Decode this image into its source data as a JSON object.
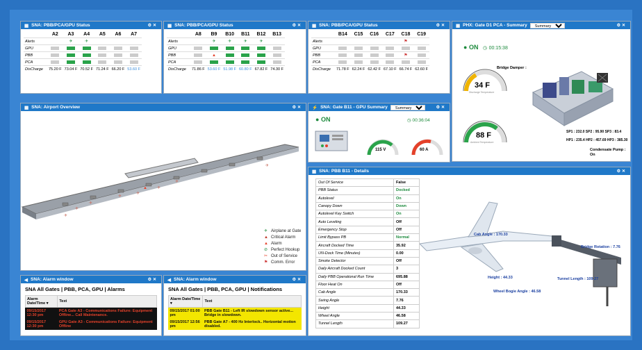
{
  "pbb_a": {
    "title": "SNA: PBB/PCA/GPU Status",
    "columns": [
      "A2",
      "A3",
      "A4",
      "A5",
      "A6",
      "A7"
    ],
    "row_labels": [
      "Alerts",
      "GPU",
      "PBB",
      "PCA",
      "DisCharge"
    ],
    "discharge": [
      "75.20 F",
      "73.04 F",
      "70.52 F",
      "71.24 F",
      "66.20 F",
      "53.60 F"
    ]
  },
  "pbb_b": {
    "title": "SNA: PBB/PCA/GPU Status",
    "columns": [
      "A8",
      "B9",
      "B10",
      "B11",
      "B12",
      "B13"
    ],
    "row_labels": [
      "Alerts",
      "GPU",
      "PBB",
      "PCA",
      "DisCharge"
    ],
    "discharge": [
      "71.86 F",
      "53.60 F",
      "51.98 F",
      "60.80 F",
      "67.82 F",
      "74.30 F"
    ]
  },
  "pbb_c": {
    "title": "SNA: PBB/PCA/GPU Status",
    "columns": [
      "B14",
      "C15",
      "C16",
      "C17",
      "C18",
      "C19"
    ],
    "row_labels": [
      "Alerts",
      "GPU",
      "PBB",
      "PCA",
      "DisCharge"
    ],
    "discharge": [
      "71.78 F",
      "62.24 F",
      "62.42 F",
      "67.10 F",
      "66.74 F",
      "62.60 F"
    ]
  },
  "phx": {
    "title": "PHX: Gate D1 PCA - Summary",
    "select": "Summary",
    "status": "ON",
    "timer": "00:15:38",
    "gauge1_value": "34 F",
    "gauge1_caption": "Discharge Temperature",
    "gauge2_value": "88 F",
    "gauge2_caption": "Ambient Temperature",
    "bridge_damper": "Bridge Damper :",
    "sp_line": "SP1 : 232.0 SP2 : 95.90  SP3 : 83.4",
    "hp_line": "HP1 : 235.4 HP2 : 457.69 HP3 : 385.30",
    "condensate": "Condensate Pump :",
    "condensate_val": "On"
  },
  "overview": {
    "title": "SNA: Airport Overview",
    "legend": [
      {
        "icon": "✈",
        "text": "Airplane at Gate"
      },
      {
        "icon": "▲",
        "text": "Critical Alarm"
      },
      {
        "icon": "▲",
        "text": "Alarm"
      },
      {
        "icon": "⊘",
        "text": "Perfect Hookup"
      },
      {
        "icon": "✂",
        "text": "Out of Service"
      },
      {
        "icon": "⚑",
        "text": "Comm. Error"
      }
    ]
  },
  "gpu": {
    "title": "SNA: Gate B11 - GPU Summary",
    "select": "Summary",
    "status": "ON",
    "timer": "00:36:04",
    "volt": "115 V",
    "amp": "60 A"
  },
  "details": {
    "title": "SNA: PBB B11 - Details",
    "rows": [
      {
        "k": "Out Of Service",
        "v": "False"
      },
      {
        "k": "PBB Status",
        "v": "Docked"
      },
      {
        "k": "Autolevel",
        "v": "On"
      },
      {
        "k": "Canopy Down",
        "v": "Down"
      },
      {
        "k": "Autolevel Key Switch",
        "v": "On"
      },
      {
        "k": "Auto Leveling",
        "v": "Off"
      },
      {
        "k": "Emergency Stop",
        "v": "Off"
      },
      {
        "k": "Limit Bypass PB",
        "v": "Normal"
      },
      {
        "k": "Aircraft Docked Time",
        "v": "35.92"
      },
      {
        "k": "UN-Dock Time (Minutes)",
        "v": "0.00"
      },
      {
        "k": "Smoke Detector",
        "v": "Off"
      },
      {
        "k": "Daily Aircraft Docked Count",
        "v": "3"
      },
      {
        "k": "Daily PBB Operational Run Time",
        "v": "695.88"
      },
      {
        "k": "Floor Heat On",
        "v": "Off"
      },
      {
        "k": "Cab Angle",
        "v": "170.33"
      },
      {
        "k": "Swing Angle",
        "v": "7.76"
      },
      {
        "k": "Height",
        "v": "44.33"
      },
      {
        "k": "Wheel Angle",
        "v": "46.58"
      },
      {
        "k": "Tunnel Length",
        "v": "109.27"
      }
    ],
    "labels": {
      "cab": "Cab Angle : 170.33",
      "rotation": "Bridge Rotation : 7.76",
      "height": "Height : 44.33",
      "tunnel": "Tunnel Length : 109.27",
      "wheel": "Wheel Bogie Angle : 46.58"
    }
  },
  "alarm1": {
    "title": "SNA: Alarm window",
    "heading": "SNA All Gates | PBB, PCA, GPU | Alarms",
    "col_time": "Alarm Date/Time",
    "col_text": "Text",
    "rows": [
      {
        "time": "09/15/2017 12:30 pm",
        "text": "PCA Gate A3 - Communications Failure: Equipment Offline... Call Maintenance."
      },
      {
        "time": "09/15/2017 12:30 pm",
        "text": "GPU Gate A3 - Communications Failure: Equipment Offline"
      }
    ]
  },
  "alarm2": {
    "title": "SNA: Alarm window",
    "heading": "SNA All Gates | PBB, PCA, GPU | Notifications",
    "col_time": "Alarm Date/Time",
    "col_text": "Text",
    "rows": [
      {
        "time": "09/15/2017 01:00 pm",
        "text": "PBB Gate B11 - Left IR slowdown sensor active... Bridge in slowdown."
      },
      {
        "time": "09/15/2017 12:56 pm",
        "text": "PBB Gate A7 - 400 Hz Interlock.. Horizontal motion disabled."
      }
    ]
  },
  "colors": {
    "header": "#1f78c8",
    "ok": "#2aa34a",
    "alarm": "#e4412a",
    "notify": "#f3e600",
    "alarm_bg": "#111111"
  }
}
